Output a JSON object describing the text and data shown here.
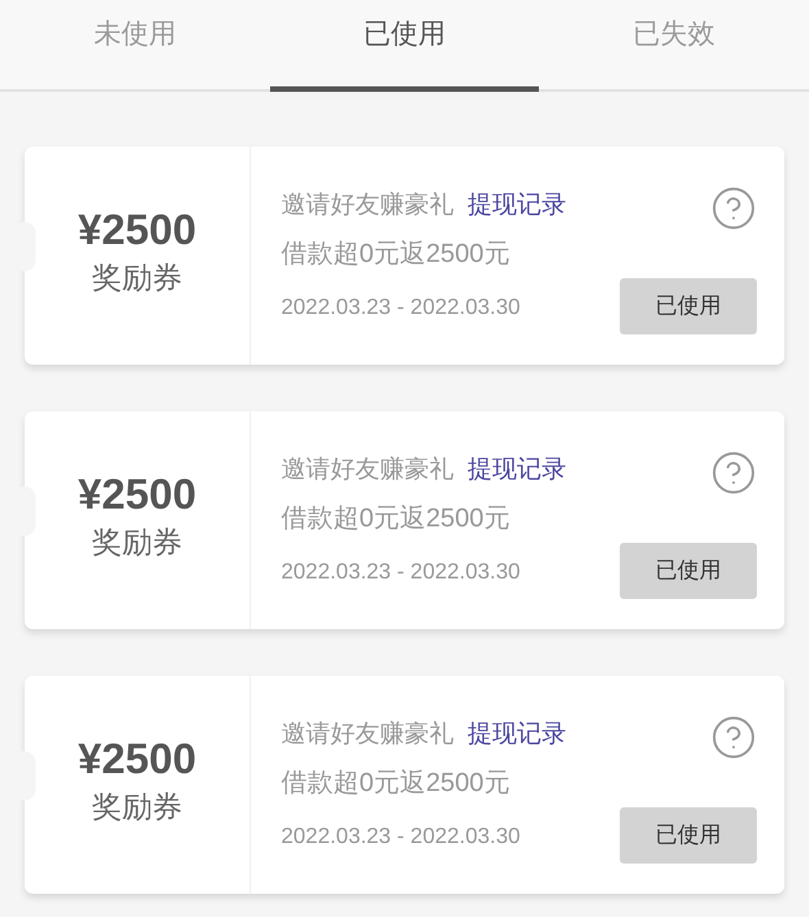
{
  "tabs": [
    {
      "label": "未使用",
      "selected": false
    },
    {
      "label": "已使用",
      "selected": true
    },
    {
      "label": "已失效",
      "selected": false
    }
  ],
  "coupons": [
    {
      "amount": "¥2500",
      "type": "奖励券",
      "title": "邀请好友赚豪礼",
      "link": "提现记录",
      "condition": "借款超0元返2500元",
      "period": "2022.03.23 - 2022.03.30",
      "status": "已使用"
    },
    {
      "amount": "¥2500",
      "type": "奖励券",
      "title": "邀请好友赚豪礼",
      "link": "提现记录",
      "condition": "借款超0元返2500元",
      "period": "2022.03.23 - 2022.03.30",
      "status": "已使用"
    },
    {
      "amount": "¥2500",
      "type": "奖励券",
      "title": "邀请好友赚豪礼",
      "link": "提现记录",
      "condition": "借款超0元返2500元",
      "period": "2022.03.23 - 2022.03.30",
      "status": "已使用"
    }
  ]
}
